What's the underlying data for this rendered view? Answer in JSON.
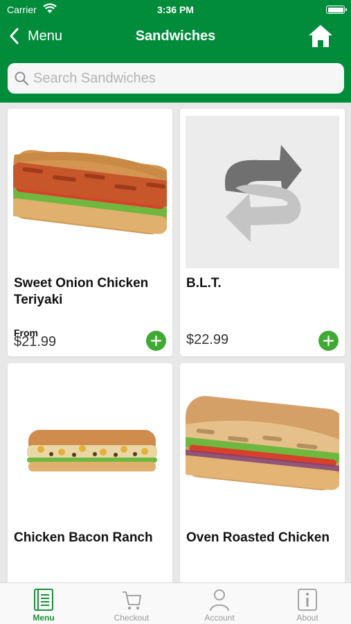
{
  "status": {
    "carrier": "Carrier",
    "time": "3:36 PM"
  },
  "nav": {
    "back_label": "Menu",
    "title": "Sandwiches"
  },
  "search": {
    "placeholder": "Search Sandwiches",
    "value": ""
  },
  "products": [
    {
      "name": "Sweet Onion Chicken Teriyaki",
      "from_label": "From",
      "price": "$21.99",
      "image": "teriyaki-sandwich"
    },
    {
      "name": "B.L.T.",
      "from_label": "",
      "price": "$22.99",
      "image": "subway-placeholder-logo"
    },
    {
      "name": "Chicken Bacon Ranch",
      "image": "chicken-bacon-ranch-sandwich"
    },
    {
      "name": "Oven Roasted Chicken",
      "image": "oven-roasted-chicken-sandwich"
    }
  ],
  "tabs": [
    {
      "label": "Menu",
      "icon": "menu-book-icon",
      "active": true
    },
    {
      "label": "Checkout",
      "icon": "cart-icon",
      "active": false
    },
    {
      "label": "Account",
      "icon": "person-icon",
      "active": false
    },
    {
      "label": "About",
      "icon": "info-icon",
      "active": false
    }
  ],
  "colors": {
    "brand_green": "#008c3a",
    "add_button": "#3eaa33",
    "active_tab": "#1b8f3a",
    "inactive_tab": "#9a9a9a"
  }
}
